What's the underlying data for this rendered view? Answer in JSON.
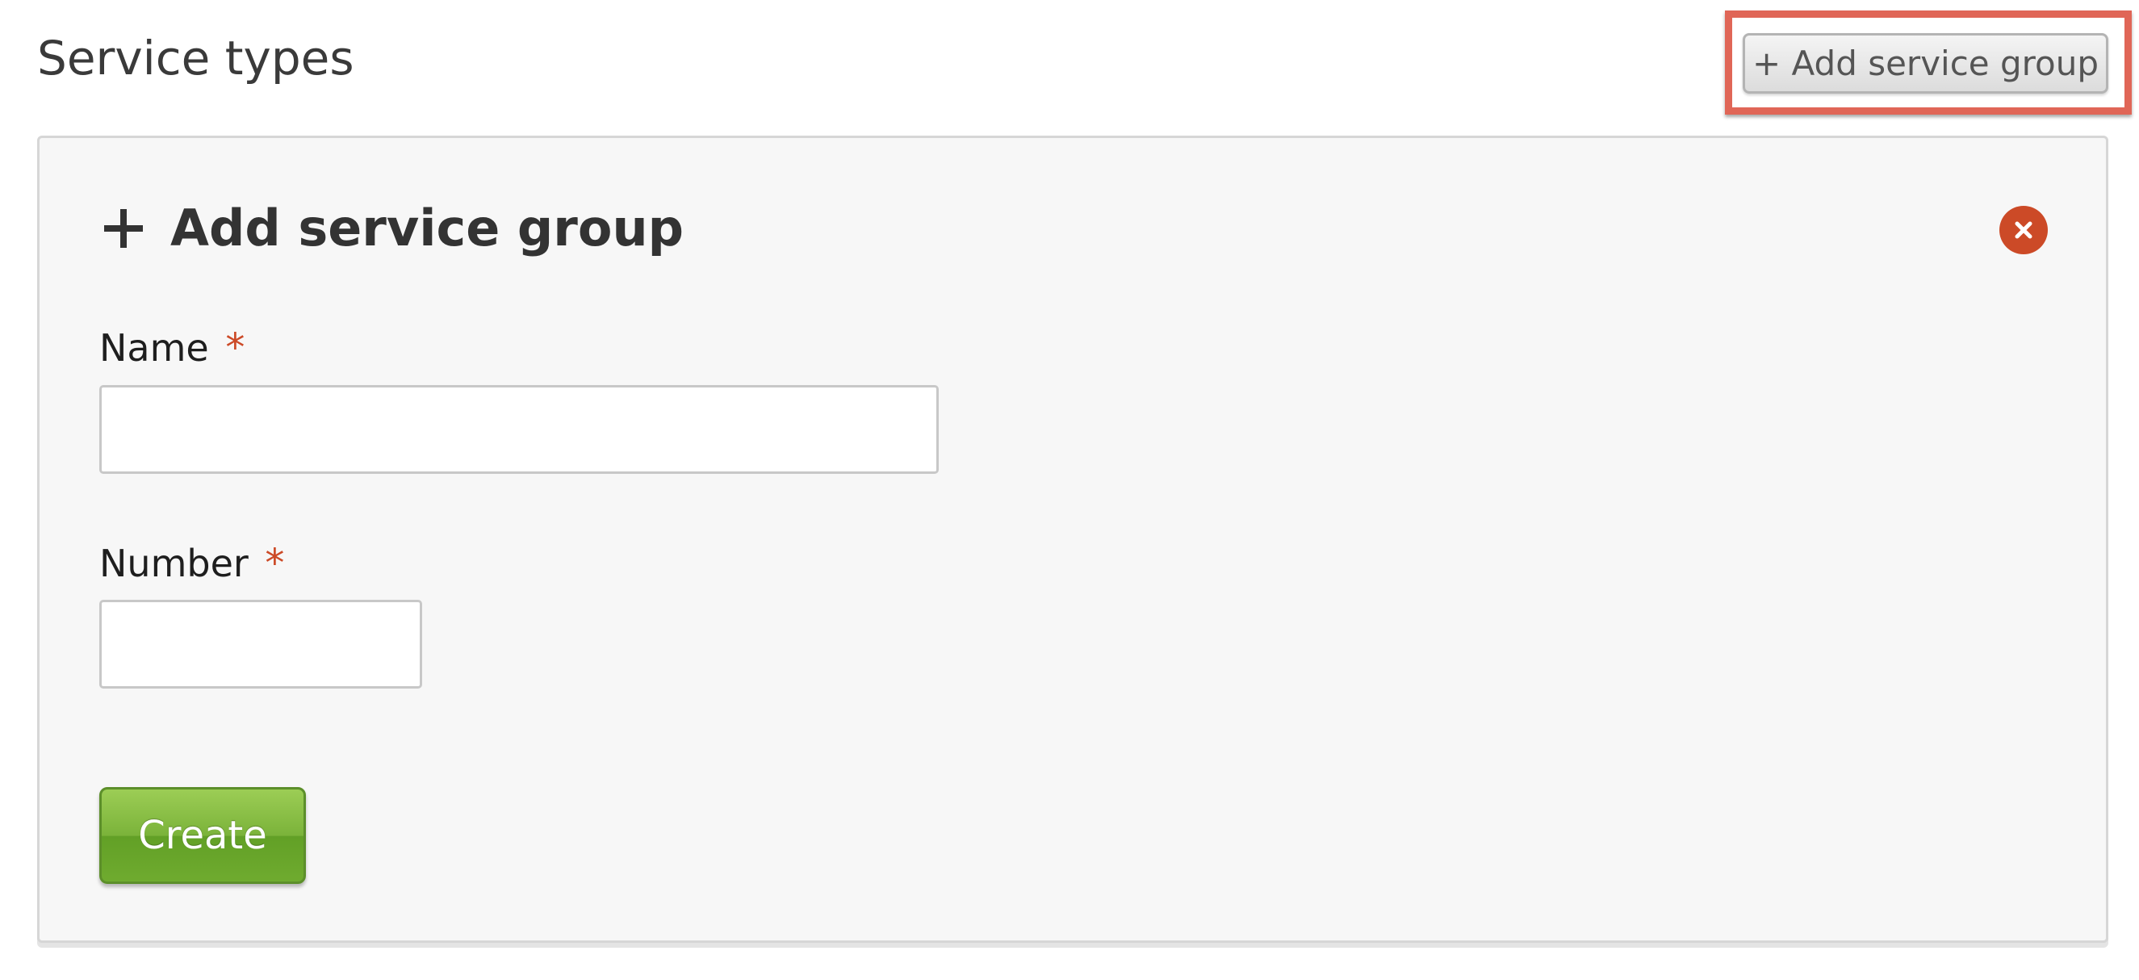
{
  "page": {
    "title": "Service types"
  },
  "toolbar": {
    "add_group_label": "+ Add service group"
  },
  "form": {
    "title": "Add service group",
    "header_icon": "plus-icon",
    "close_icon": "close-icon",
    "fields": [
      {
        "label": "Name",
        "required_marker": "*",
        "value": "",
        "placeholder": ""
      },
      {
        "label": "Number",
        "required_marker": "*",
        "value": "",
        "placeholder": ""
      }
    ],
    "submit_label": "Create"
  },
  "colors": {
    "highlight": "#e06657",
    "required": "#cc4a27",
    "close_button": "#cc4a27",
    "primary_button": "#6fab2f",
    "panel_background": "#f7f7f7"
  }
}
